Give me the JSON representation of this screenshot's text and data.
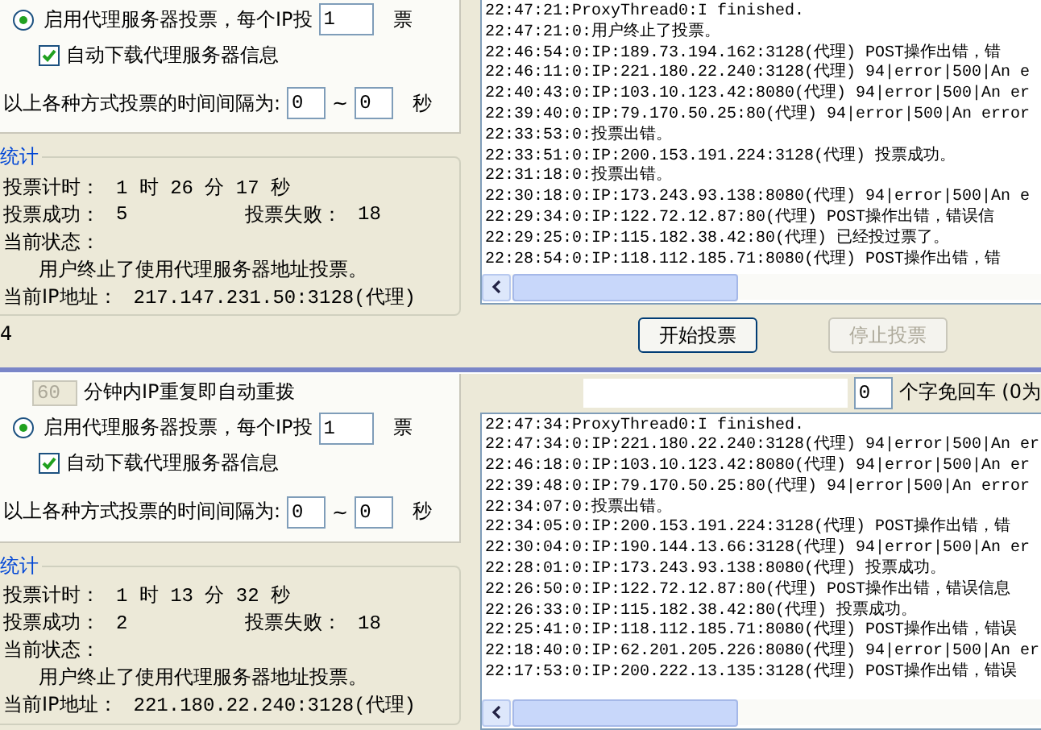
{
  "panels": [
    {
      "proxy_option": {
        "label": "启用代理服务器投票，每个IP投",
        "votes_per_ip": "1",
        "unit": "票",
        "selected": true
      },
      "auto_download": {
        "label": "自动下载代理服务器信息",
        "checked": true
      },
      "interval": {
        "label": "以上各种方式投票的时间间隔为:",
        "min": "0",
        "separator": "~",
        "max": "0",
        "unit": "秒"
      },
      "stats": {
        "legend": "统计",
        "timer_label": "投票计时：",
        "timer": "1 时 26 分 17 秒",
        "success_label": "投票成功：",
        "success": "5",
        "fail_label": "投票失败：",
        "fail": "18",
        "status_label": "当前状态：",
        "status": "用户终止了使用代理服务器地址投票。",
        "ip_label": "当前IP地址：",
        "ip": "217.147.231.50:3128(代理)"
      },
      "footer_text": "4",
      "log": [
        "22:47:21:ProxyThread0:I finished.",
        "22:47:21:0:用户终止了投票。",
        "22:46:54:0:IP:189.73.194.162:3128(代理) POST操作出错，错",
        "22:46:11:0:IP:221.180.22.240:3128(代理) 94|error|500|An e",
        "22:40:43:0:IP:103.10.123.42:8080(代理) 94|error|500|An er",
        "22:39:40:0:IP:79.170.50.25:80(代理) 94|error|500|An error",
        "22:33:53:0:投票出错。",
        "22:33:51:0:IP:200.153.191.224:3128(代理) 投票成功。",
        "22:31:18:0:投票出错。",
        "22:30:18:0:IP:173.243.93.138:8080(代理) 94|error|500|An e",
        "22:29:34:0:IP:122.72.12.87:80(代理) POST操作出错，错误信",
        "22:29:25:0:IP:115.182.38.42:80(代理) 已经投过票了。",
        "22:28:54:0:IP:118.112.185.71:8080(代理) POST操作出错，错"
      ],
      "buttons": [
        {
          "label": "开始投票",
          "disabled": false
        },
        {
          "label": "停止投票",
          "disabled": true
        }
      ]
    },
    {
      "redial": {
        "minutes": "60",
        "label": "分钟内IP重复即自动重拨",
        "disabled": true
      },
      "char_limit": {
        "value": "0",
        "label": "个字免回车 (0为"
      },
      "proxy_option": {
        "label": "启用代理服务器投票，每个IP投",
        "votes_per_ip": "1",
        "unit": "票",
        "selected": true
      },
      "auto_download": {
        "label": "自动下载代理服务器信息",
        "checked": true
      },
      "interval": {
        "label": "以上各种方式投票的时间间隔为:",
        "min": "0",
        "separator": "~",
        "max": "0",
        "unit": "秒"
      },
      "stats": {
        "legend": "统计",
        "timer_label": "投票计时：",
        "timer": "1 时 13 分 32 秒",
        "success_label": "投票成功：",
        "success": "2",
        "fail_label": "投票失败：",
        "fail": "18",
        "status_label": "当前状态：",
        "status": "用户终止了使用代理服务器地址投票。",
        "ip_label": "当前IP地址：",
        "ip": "221.180.22.240:3128(代理)"
      },
      "log": [
        "22:47:34:ProxyThread0:I finished.",
        "22:47:34:0:IP:221.180.22.240:3128(代理) 94|error|500|An er",
        "22:46:18:0:IP:103.10.123.42:8080(代理) 94|error|500|An er",
        "22:39:48:0:IP:79.170.50.25:80(代理) 94|error|500|An error",
        "22:34:07:0:投票出错。",
        "22:34:05:0:IP:200.153.191.224:3128(代理) POST操作出错，错",
        "22:30:04:0:IP:190.144.13.66:3128(代理) 94|error|500|An er",
        "22:28:01:0:IP:173.243.93.138:8080(代理) 投票成功。",
        "22:26:50:0:IP:122.72.12.87:80(代理) POST操作出错，错误信息",
        "22:26:33:0:IP:115.182.38.42:80(代理) 投票成功。",
        "22:25:41:0:IP:118.112.185.71:8080(代理) POST操作出错，错误",
        "22:18:40:0:IP:62.201.205.226:8080(代理) 94|error|500|An er",
        "22:17:53:0:IP:200.222.13.135:3128(代理) POST操作出错，错误"
      ]
    }
  ]
}
